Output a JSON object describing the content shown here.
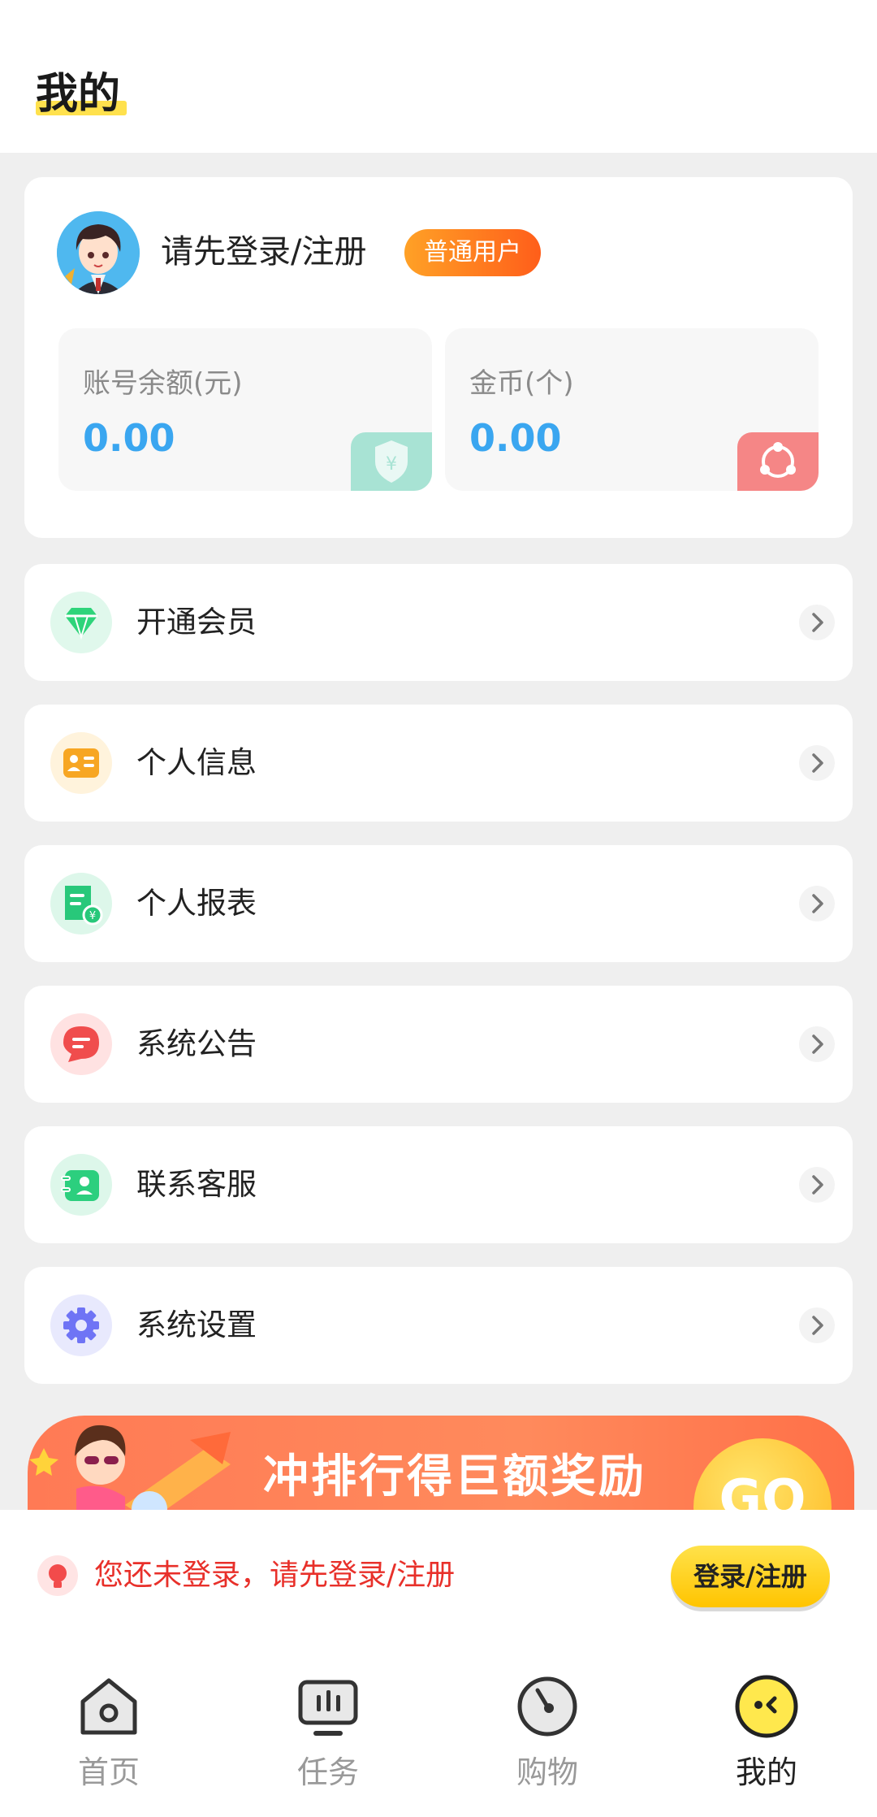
{
  "header": {
    "title": "我的"
  },
  "profile": {
    "login_prompt": "请先登录/注册",
    "user_level": "普通用户",
    "balance": {
      "label": "账号余额(元)",
      "value": "0.00"
    },
    "coins": {
      "label": "金币(个)",
      "value": "0.00"
    }
  },
  "menu": [
    {
      "label": "开通会员",
      "icon": "diamond-icon",
      "color": "#2ed47a"
    },
    {
      "label": "个人信息",
      "icon": "id-card-icon",
      "color": "#f7a623"
    },
    {
      "label": "个人报表",
      "icon": "report-icon",
      "color": "#28c87a"
    },
    {
      "label": "系统公告",
      "icon": "message-icon",
      "color": "#f04d4d"
    },
    {
      "label": "联系客服",
      "icon": "contact-icon",
      "color": "#2ccf7e"
    },
    {
      "label": "系统设置",
      "icon": "gear-icon",
      "color": "#6f74f5"
    }
  ],
  "banner": {
    "text": "冲排行得巨额奖励",
    "go": "GO"
  },
  "login_bar": {
    "hint": "您还未登录，请先登录/注册",
    "button": "登录/注册"
  },
  "tabs": [
    {
      "label": "首页",
      "icon": "home-icon"
    },
    {
      "label": "任务",
      "icon": "task-icon"
    },
    {
      "label": "购物",
      "icon": "shopping-icon"
    },
    {
      "label": "我的",
      "icon": "profile-icon",
      "active": true
    }
  ]
}
